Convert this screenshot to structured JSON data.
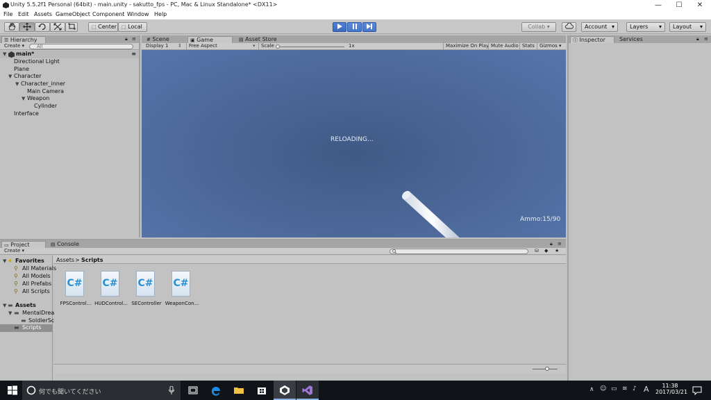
{
  "titlebar": {
    "title": "Unity 5.5.2f1 Personal (64bit) - main.unity - sakutto_fps - PC, Mac & Linux Standalone* <DX11>",
    "minimize": "—",
    "maximize": "☐",
    "close": "✕"
  },
  "menu": [
    "File",
    "Edit",
    "Assets",
    "GameObject",
    "Component",
    "Window",
    "Help"
  ],
  "toolbar": {
    "pivot": "Center",
    "space": "Local",
    "collab": "Collab ▾",
    "account": "Account",
    "layers": "Layers",
    "layout": "Layout"
  },
  "hierarchy": {
    "tab": "Hierarchy",
    "create": "Create",
    "search_placeholder": "All",
    "scene": "main*",
    "items": [
      "Directional Light",
      "Plane",
      "Character",
      "Character_inner",
      "Main Camera",
      "Weapon",
      "Cylinder",
      "Interface"
    ]
  },
  "views": {
    "tabs": [
      "Scene",
      "Game",
      "Asset Store"
    ],
    "display": "Display 1",
    "aspect": "Free Aspect",
    "scale_label": "Scale",
    "scale_value": "1x",
    "maximize_on_play": "Maximize On Play",
    "mute_audio": "Mute Audio",
    "stats": "Stats",
    "gizmos": "Gizmos"
  },
  "game": {
    "reload_text": "RELOADING...",
    "ammo_text": "Ammo:15/90"
  },
  "inspector": {
    "tabs": [
      "Inspector",
      "Services"
    ]
  },
  "project": {
    "tabs": [
      "Project",
      "Console"
    ],
    "create": "Create",
    "breadcrumb": [
      "Assets",
      "Scripts"
    ],
    "favorites_label": "Favorites",
    "favorites": [
      "All Materials",
      "All Models",
      "All Prefabs",
      "All Scripts"
    ],
    "assets_label": "Assets",
    "folders": [
      "MentalDrea",
      "SoldierSc",
      "Scripts"
    ],
    "files": [
      "FPSControl...",
      "HUDControl...",
      "SEController",
      "WeaponCon..."
    ],
    "file_glyph": "C#"
  },
  "taskbar": {
    "search_placeholder": "何でも聞いてください",
    "time": "11:38",
    "date": "2017/03/21",
    "ime": "A"
  }
}
